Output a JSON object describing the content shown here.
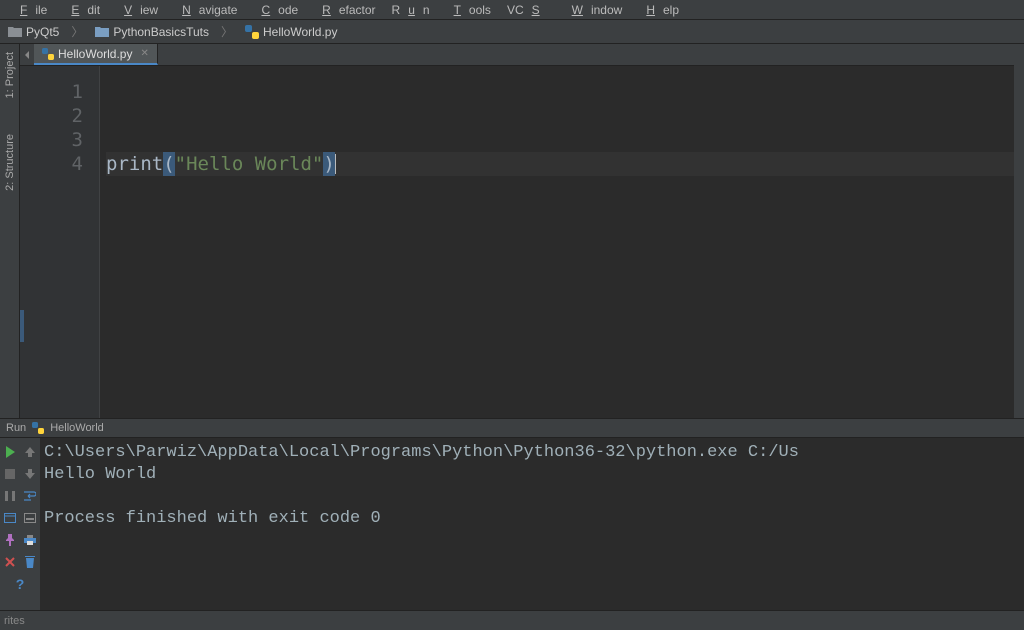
{
  "menu": [
    "File",
    "Edit",
    "View",
    "Navigate",
    "Code",
    "Refactor",
    "Run",
    "Tools",
    "VCS",
    "Window",
    "Help"
  ],
  "breadcrumbs": {
    "root": "PyQt5",
    "folder": "PythonBasicsTuts",
    "file": "HelloWorld.py"
  },
  "side_tabs": {
    "project": "1: Project",
    "structure": "2: Structure"
  },
  "editor": {
    "tab_label": "HelloWorld.py",
    "lines": [
      "1",
      "2",
      "3",
      "4"
    ],
    "code": {
      "func": "print",
      "lparen": "(",
      "string": "\"Hello World\"",
      "rparen": ")"
    }
  },
  "run": {
    "label": "Run",
    "config": "HelloWorld",
    "console": {
      "line1": "C:\\Users\\Parwiz\\AppData\\Local\\Programs\\Python\\Python36-32\\python.exe C:/Us",
      "line2": "Hello World",
      "blank": "",
      "line3": "Process finished with exit code 0"
    }
  },
  "bottom": {
    "label": "rites"
  }
}
